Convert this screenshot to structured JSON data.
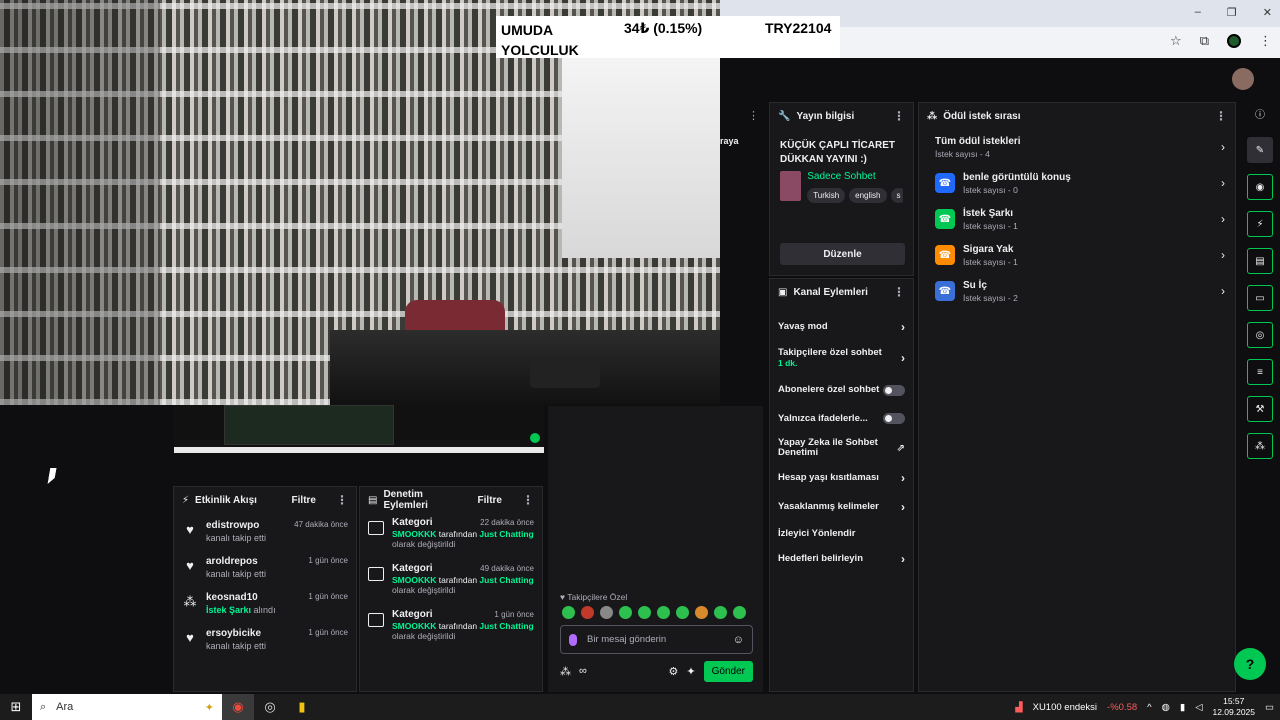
{
  "ticker": {
    "name": "UMUDA YOLCULUK",
    "change": "34₺ (0.15%)",
    "symbol": "TRY22104"
  },
  "partial_text": {
    "raya": "raya"
  },
  "activity_feed": {
    "title": "Etkinlik Akışı",
    "filter": "Filtre",
    "items": [
      {
        "icon": "heart-icon",
        "name": "edistrowpo",
        "sub": "kanalı takip etti",
        "sub_highlight": "",
        "time": "47 dakika önce"
      },
      {
        "icon": "heart-icon",
        "name": "aroldrepos",
        "sub": "kanalı takip etti",
        "sub_highlight": "",
        "time": "1 gün önce"
      },
      {
        "icon": "reward-icon",
        "name": "keosnad10",
        "sub": "alındı",
        "sub_highlight": "İstek Şarkı",
        "time": "1 gün önce"
      },
      {
        "icon": "heart-icon",
        "name": "ersoybicike",
        "sub": "kanalı takip etti",
        "sub_highlight": "",
        "time": "1 gün önce"
      }
    ]
  },
  "mod_actions": {
    "title": "Denetim Eylemleri",
    "filter": "Filtre",
    "items": [
      {
        "title": "Kategori",
        "time": "22 dakika önce",
        "user": "SMOOKKK",
        "mid": "tarafından",
        "target": "Just Chatting",
        "tail": "olarak değiştirildi"
      },
      {
        "title": "Kategori",
        "time": "49 dakika önce",
        "user": "SMOOKKK",
        "mid": "tarafından",
        "target": "Just Chatting",
        "tail": "olarak değiştirildi"
      },
      {
        "title": "Kategori",
        "time": "1 gün önce",
        "user": "SMOOKKK",
        "mid": "tarafından",
        "target": "Just Chatting",
        "tail": "olarak değiştirildi"
      }
    ]
  },
  "chat": {
    "followers_only": "Takipçilere Özel",
    "placeholder": "Bir mesaj gönderin",
    "points": "∞",
    "send": "Gönder"
  },
  "stream_info": {
    "title": "Yayın bilgisi",
    "stream_title": "KÜÇÜK ÇAPLI TİCARET DÜKKAN YAYINI :)",
    "category": "Sadece Sohbet",
    "tags": [
      "Turkish",
      "english",
      "s"
    ],
    "edit": "Düzenle"
  },
  "channel_actions": {
    "title": "Kanal Eylemleri",
    "items": [
      {
        "label": "Yavaş mod",
        "control": "chevron",
        "sub": ""
      },
      {
        "label": "Takipçilere özel sohbet",
        "control": "chevron",
        "sub": "1 dk."
      },
      {
        "label": "Abonelere özel sohbet",
        "control": "toggle",
        "sub": ""
      },
      {
        "label": "Yalnızca ifadelerle...",
        "control": "toggle",
        "sub": ""
      },
      {
        "label": "Yapay Zeka ile Sohbet Denetimi",
        "control": "external",
        "sub": ""
      },
      {
        "label": "Hesap yaşı kısıtlaması",
        "control": "chevron",
        "sub": ""
      },
      {
        "label": "Yasaklanmış kelimeler",
        "control": "chevron",
        "sub": ""
      },
      {
        "label": "İzleyici Yönlendir",
        "control": "none",
        "sub": ""
      },
      {
        "label": "Hedefleri belirleyin",
        "control": "chevron",
        "sub": ""
      }
    ]
  },
  "reward_queue": {
    "title": "Ödül istek sırası",
    "all": {
      "name": "Tüm ödül istekleri",
      "count": "İstek sayısı - 4"
    },
    "items": [
      {
        "name": "benle görüntülü konuş",
        "count": "İstek sayısı - 0",
        "color": "#1f69ff"
      },
      {
        "name": "İstek Şarkı",
        "count": "İstek sayısı - 1",
        "color": "#00c853"
      },
      {
        "name": "Sigara Yak",
        "count": "İstek sayısı - 1",
        "color": "#ff8c00"
      },
      {
        "name": "Su İç",
        "count": "İstek sayısı - 2",
        "color": "#3b6fd8"
      }
    ]
  },
  "taskbar": {
    "search": "Ara",
    "index_name": "XU100 endeksi",
    "index_change": "-%0.58",
    "time": "15:57",
    "date": "12.09.2025"
  },
  "colors": {
    "accent": "#00c853",
    "highlight": "#00f593",
    "panel": "#18181b",
    "bg": "#0e0e10"
  }
}
